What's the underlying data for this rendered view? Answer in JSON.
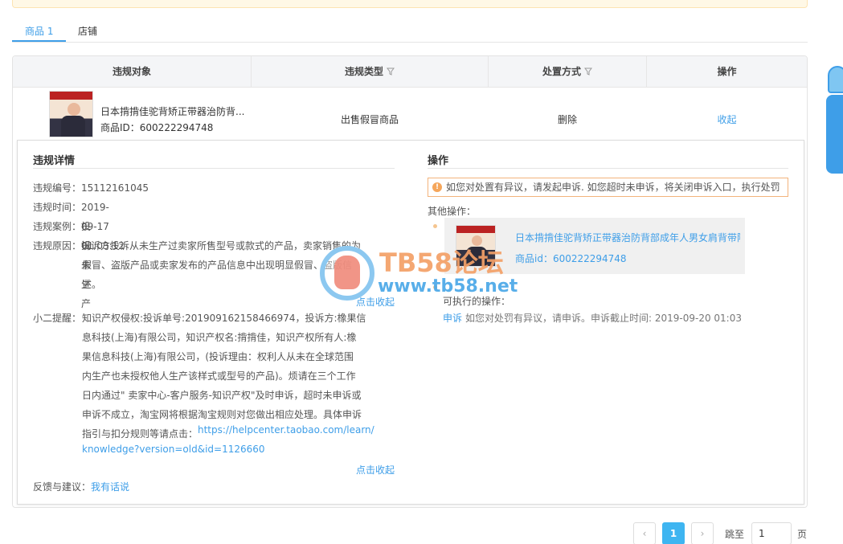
{
  "tabs": [
    {
      "label": "商品 1"
    },
    {
      "label": "店铺"
    }
  ],
  "table": {
    "headers": [
      "违规对象",
      "违规类型",
      "处置方式",
      "操作"
    ],
    "row": {
      "product_title": "日本揹揹佳驼背矫正带器治防背...",
      "product_id": "商品ID：600222294748",
      "violation_type": "出售假冒商品",
      "action_taken": "删除",
      "operation": "收起"
    }
  },
  "detail": {
    "left_title": "违规详情",
    "fields": [
      {
        "key": "违规编号：",
        "value": "15112161045"
      },
      {
        "key": "违规时间：",
        "value": "2019-09-17 01:03:12"
      },
      {
        "key": "违规案例：",
        "value": "投诉未生产"
      },
      {
        "key": "违规原因：",
        "value": "投诉方投诉从未生产过卖家所售型号或款式的产品，卖家销售的为"
      }
    ],
    "reason_cont": "假冒、盗版产品或卖家发布的产品信息中出现明显假冒、盗版信\n述。",
    "collapse1": "点击收起",
    "tip_key": "小二提醒：",
    "tip_text": "知识产权侵权:投诉单号:201909162158466974，投诉方:橡果信\n息科技(上海)有限公司，知识产权名:揹揹佳，知识产权所有人:橡\n果信息科技(上海)有限公司，(投诉理由：权利人从未在全球范围\n内生产也未授权他人生产该样式或型号的产品)。烦请在三个工作\n日内通过\" 卖家中心-客户服务-知识产权\"及时申诉，超时未申诉或\n申诉不成立，淘宝网将根据淘宝规则对您做出相应处理。具体申诉\n指引与扣分规则等请点击：",
    "tip_link_1": "https://helpcenter.taobao.com/learn/",
    "tip_link_2": "knowledge?version=old&id=1126660",
    "collapse2": "点击收起",
    "feedback_key": "反馈与建议：",
    "feedback_link": "我有话说",
    "right_title": "操作",
    "warning": "如您对处置有异议，请发起申诉. 如您超时未申诉，将关闭申诉入口，执行处罚",
    "other_ops": "其他操作：",
    "card_title": "日本揹揹佳驼背矫正带器治防背部成年人男女肩背带隐形",
    "card_id": "商品id：600222294748",
    "executable": "可执行的操作：",
    "appeal_link": "申诉",
    "appeal_text": "如您对处罚有异议，请申诉。申诉截止时间: 2019-09-20 01:03"
  },
  "watermark": {
    "line1": "TB58论坛",
    "line2": "www.tb58.net"
  },
  "pager": {
    "prev": "‹",
    "current": "1",
    "next": "›",
    "jump_label": "跳至",
    "jump_value": "1",
    "page_unit": "页"
  },
  "colors": {
    "accent": "#3e9ee8",
    "warning": "#f5a65b"
  }
}
